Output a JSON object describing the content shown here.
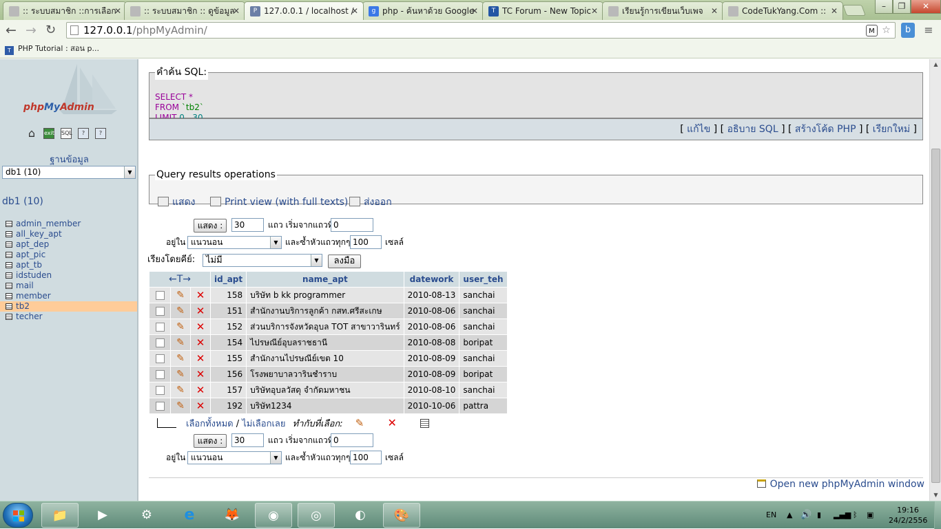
{
  "browser": {
    "tabs": [
      {
        "title": ":: ระบบสมาชิก ::การเลือก",
        "icon": "page-icon",
        "color": "#b9b9b9"
      },
      {
        "title": ":: ระบบสมาชิก :: ดูข้อมูล",
        "icon": "page-icon",
        "color": "#b9b9b9"
      },
      {
        "title": "127.0.0.1 / localhost /",
        "icon": "pma-icon",
        "color": "#6b7fa6"
      },
      {
        "title": "php - ค้นหาด้วย Google",
        "icon": "google-icon",
        "color": "#3b78e7"
      },
      {
        "title": "TC Forum - New Topic",
        "icon": "forum-icon",
        "color": "#2456a4"
      },
      {
        "title": "เรียนรู้การเขียนเว็บเพจ",
        "icon": "page-icon",
        "color": "#b9b9b9"
      },
      {
        "title": "CodeTukYang.Com ::",
        "icon": "page-icon",
        "color": "#b9b9b9"
      }
    ],
    "url_host": "127.0.0.1",
    "url_path": "/phpMyAdmin/",
    "bookmark": "PHP Tutorial : สอน p..."
  },
  "nav": {
    "logo_php": "php",
    "logo_my": "My",
    "logo_admin": "Admin",
    "icons": [
      "home-icon",
      "exit-icon",
      "sql-icon",
      "help-icon",
      "docs-icon"
    ],
    "icon_labels": [
      "⌂",
      "exit",
      "SQL",
      "?",
      "?"
    ],
    "db_label": "ฐานข้อมูล",
    "db_selected": "db1 (10)",
    "db_name": "db1 (10)",
    "tables": [
      "admin_member",
      "all_key_apt",
      "apt_dep",
      "apt_pic",
      "apt_tb",
      "idstuden",
      "mail",
      "member",
      "tb2",
      "techer"
    ],
    "active_table": "tb2"
  },
  "sql": {
    "legend": "คำค้น SQL:",
    "line1_kw": "SELECT",
    "line1_rest": "*",
    "line2_kw": "FROM",
    "line2_tbl": "`tb2`",
    "line3_kw": "LIMIT",
    "line3_a": "0",
    "line3_sep": ",",
    "line3_b": "30",
    "actions": [
      "แก้ไข",
      "อธิบาย SQL",
      "สร้างโค้ด PHP",
      "เรียกใหม่"
    ]
  },
  "qro": {
    "legend": "Query results operations",
    "show": "แสดง",
    "print_view": "Print view (with full texts)",
    "export": "ส่งออก"
  },
  "navform": {
    "show_button": "แสดง :",
    "rows_value": "30",
    "rows_label": "แถว เริ่มจากแถวที่",
    "start_value": "0",
    "mode_label": "อยู่ใน",
    "mode_value": "แนวนอน",
    "repeat_label": "และซ้ำหัวแถวทุกๆ",
    "repeat_value": "100",
    "cells_label": "เซลล์",
    "sort_label": "เรียงโดยคีย์:",
    "sort_value": "ไม่มี",
    "go_button": "ลงมือ"
  },
  "table": {
    "arrows": "←T→",
    "columns": [
      "id_apt",
      "name_apt",
      "datework",
      "user_teh"
    ],
    "rows": [
      {
        "id": "158",
        "name": "บริษัท b kk programmer",
        "date": "2010-08-13",
        "user": "sanchai"
      },
      {
        "id": "151",
        "name": "สำนักงานบริการลูกค้า กสท.ศรีสะเกษ",
        "date": "2010-08-06",
        "user": "sanchai"
      },
      {
        "id": "152",
        "name": "ส่วนบริการจังหวัดอุบล TOT สาขาวารินทร์",
        "date": "2010-08-06",
        "user": "sanchai"
      },
      {
        "id": "154",
        "name": "ไปรษณีย์อุบลราชธานี",
        "date": "2010-08-08",
        "user": "boripat"
      },
      {
        "id": "155",
        "name": "สำนักงานไปรษณีย์เขต 10",
        "date": "2010-08-09",
        "user": "sanchai"
      },
      {
        "id": "156",
        "name": "โรงพยาบาลวารินชำราบ",
        "date": "2010-08-09",
        "user": "boripat"
      },
      {
        "id": "157",
        "name": "บริษัทอุบลวัสดุ จำกัดมหาชน",
        "date": "2010-08-10",
        "user": "sanchai"
      },
      {
        "id": "192",
        "name": "บริษัท1234",
        "date": "2010-10-06",
        "user": "pattra"
      }
    ]
  },
  "selection": {
    "check_all": "เลือกทั้งหมด",
    "separator": " / ",
    "uncheck_all": "ไม่เลือกเลย",
    "with_selected": "ทำกับที่เลือก:"
  },
  "footer": {
    "open_new": "Open new phpMyAdmin window"
  },
  "taskbar": {
    "lang": "EN",
    "time": "19:16",
    "date": "24/2/2556"
  }
}
